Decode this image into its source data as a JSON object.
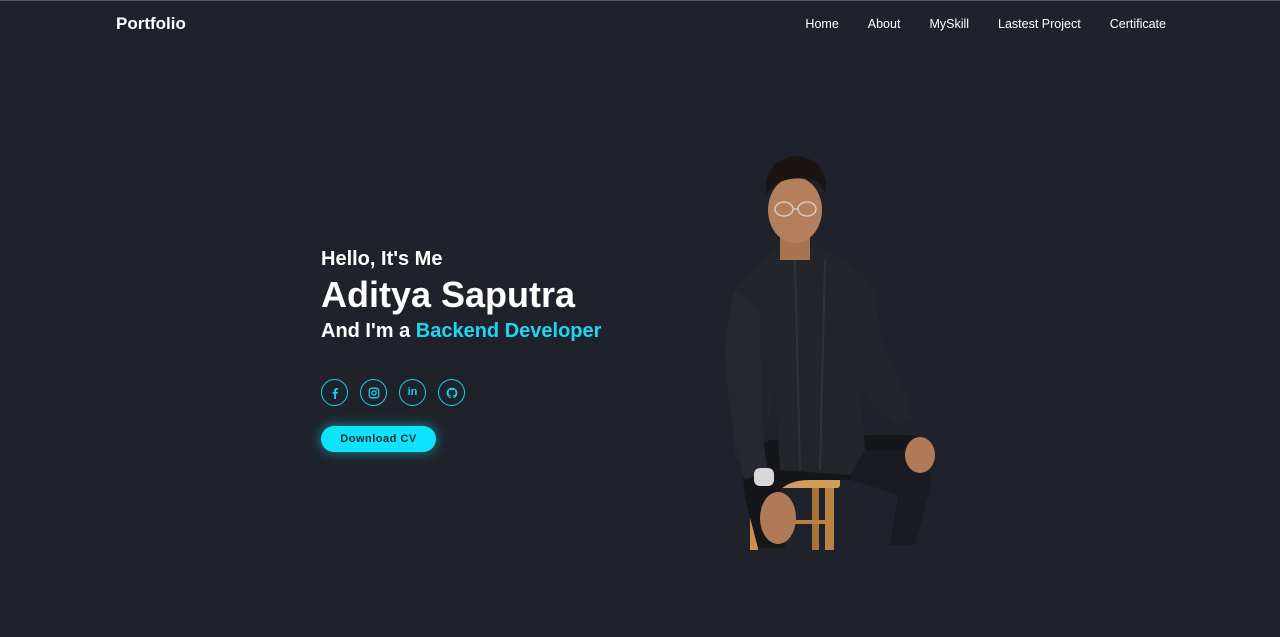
{
  "header": {
    "logo": "Portfolio",
    "nav": [
      {
        "label": "Home"
      },
      {
        "label": "About"
      },
      {
        "label": "MySkill"
      },
      {
        "label": "Lastest Project"
      },
      {
        "label": "Certificate"
      }
    ]
  },
  "hero": {
    "greeting": "Hello, It's Me",
    "name": "Aditya Saputra",
    "role_prefix": "And I'm a",
    "role": "Backend Developer",
    "download_label": "Download CV"
  },
  "socials": [
    {
      "icon": "facebook-icon"
    },
    {
      "icon": "instagram-icon"
    },
    {
      "icon": "linkedin-icon",
      "text": "in"
    },
    {
      "icon": "github-icon"
    }
  ],
  "colors": {
    "background": "#1f222b",
    "accent": "#1ed6ef",
    "button": "#0fe3fb"
  }
}
